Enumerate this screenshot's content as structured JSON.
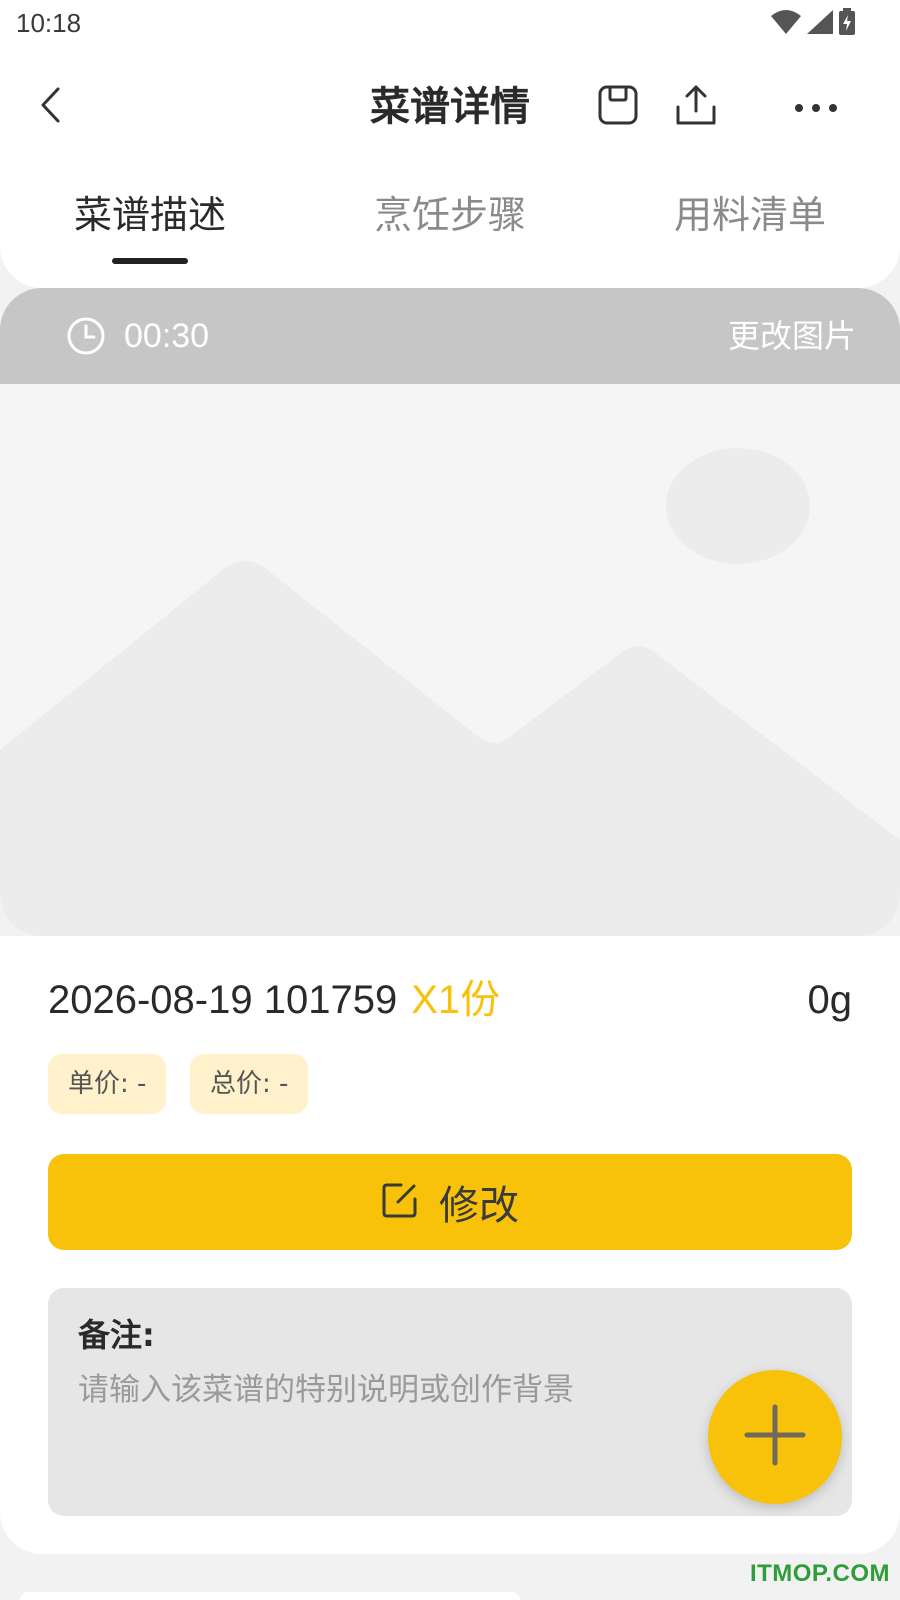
{
  "status_bar": {
    "time": "10:18",
    "icons": [
      "wifi-icon",
      "signal-icon",
      "battery-charging-icon"
    ]
  },
  "header": {
    "title": "菜谱详情",
    "actions": [
      "back-icon",
      "save-icon",
      "share-icon",
      "more-icon"
    ]
  },
  "tabs": [
    {
      "label": "菜谱描述",
      "active": true
    },
    {
      "label": "烹饪步骤",
      "active": false
    },
    {
      "label": "用料清单",
      "active": false
    }
  ],
  "photo": {
    "duration": "00:30",
    "change_label": "更改图片"
  },
  "recipe": {
    "name": "2026-08-19 101759",
    "servings": "X1份",
    "weight": "0g",
    "unit_price": "单价: -",
    "total_price": "总价: -"
  },
  "edit_button": {
    "label": "修改"
  },
  "notes": {
    "label": "备注:",
    "placeholder": "请输入该菜谱的特别说明或创作背景"
  },
  "watermark": "ITMOP.COM",
  "colors": {
    "accent": "#f8c20a",
    "price_tag_bg": "#fff1cc",
    "notes_bg": "#e6e6e6",
    "photo_bar": "#c6c6c6"
  }
}
